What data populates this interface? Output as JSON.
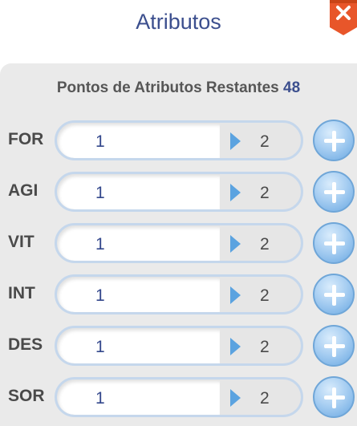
{
  "header": {
    "title": "Atributos",
    "close_icon": "close-icon"
  },
  "remaining": {
    "label": "Pontos de Atributos Restantes",
    "value": "48"
  },
  "stats": [
    {
      "label": "FOR",
      "current": "1",
      "next": "2"
    },
    {
      "label": "AGI",
      "current": "1",
      "next": "2"
    },
    {
      "label": "VIT",
      "current": "1",
      "next": "2"
    },
    {
      "label": "INT",
      "current": "1",
      "next": "2"
    },
    {
      "label": "DES",
      "current": "1",
      "next": "2"
    },
    {
      "label": "SOR",
      "current": "1",
      "next": "2"
    }
  ],
  "colors": {
    "title": "#3c4f8e",
    "close_badge": "#e8562a",
    "accent_blue": "#5ba3e0",
    "panel_bg": "#eaeaea"
  }
}
